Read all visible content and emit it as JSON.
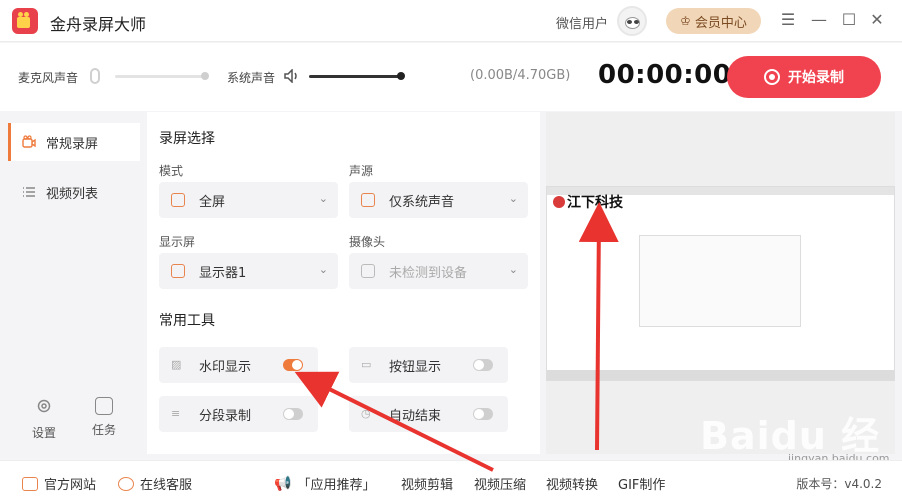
{
  "app": {
    "title": "金舟录屏大师",
    "user": "微信用户",
    "vip_label": "会员中心"
  },
  "window_controls": [
    "☰",
    "—",
    "☐",
    "✕"
  ],
  "audio": {
    "mic_label": "麦克风声音",
    "system_label": "系统声音",
    "storage": "(0.00B/4.70GB)",
    "timer": "00:00:00",
    "start_label": "开始录制"
  },
  "sidebar": {
    "items": [
      {
        "label": "常规录屏",
        "icon": "camera-icon",
        "active": true
      },
      {
        "label": "视频列表",
        "icon": "list-icon",
        "active": false
      }
    ],
    "bottom": [
      {
        "label": "设置",
        "icon": "gear-icon"
      },
      {
        "label": "任务",
        "icon": "task-icon"
      }
    ]
  },
  "panel": {
    "record_title": "录屏选择",
    "mode": {
      "label": "模式",
      "value": "全屏"
    },
    "source": {
      "label": "声源",
      "value": "仅系统声音"
    },
    "display": {
      "label": "显示屏",
      "value": "显示器1"
    },
    "camera": {
      "label": "摄像头",
      "value": "未检测到设备"
    },
    "tools_title": "常用工具",
    "tools": [
      {
        "label": "水印显示",
        "on": true
      },
      {
        "label": "按钮显示",
        "on": false
      },
      {
        "label": "分段录制",
        "on": false
      },
      {
        "label": "自动结束",
        "on": false
      }
    ]
  },
  "preview": {
    "watermark_text": "江下科技"
  },
  "footer": {
    "items": [
      "官方网站",
      "在线客服",
      "「应用推荐」",
      "视频剪辑",
      "视频压缩",
      "视频转换",
      "GIF制作"
    ],
    "version": "版本号：v4.0.2"
  },
  "overlay": {
    "baidu": "Baidu 经验",
    "url": "jingyan.baidu.com"
  },
  "colors": {
    "accent": "#ee7a3c",
    "record": "#f0434f",
    "arrow": "#e8332f"
  }
}
